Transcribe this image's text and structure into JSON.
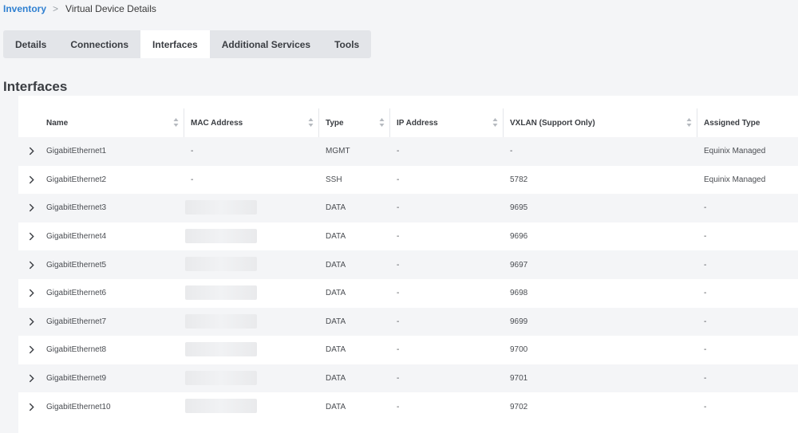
{
  "breadcrumb": {
    "root": "Inventory",
    "separator": ">",
    "current": "Virtual Device Details"
  },
  "tabs": [
    {
      "label": "Details",
      "active": false
    },
    {
      "label": "Connections",
      "active": false
    },
    {
      "label": "Interfaces",
      "active": true
    },
    {
      "label": "Additional Services",
      "active": false
    },
    {
      "label": "Tools",
      "active": false
    }
  ],
  "section_title": "Interfaces",
  "table": {
    "columns": [
      "Name",
      "MAC Address",
      "Type",
      "IP Address",
      "VXLAN (Support Only)",
      "Assigned Type"
    ],
    "rows": [
      {
        "name": "GigabitEthernet1",
        "mac": "-",
        "type": "MGMT",
        "ip": "-",
        "vxlan": "-",
        "assigned": "Equinix Managed",
        "mac_redacted": false
      },
      {
        "name": "GigabitEthernet2",
        "mac": "-",
        "type": "SSH",
        "ip": "-",
        "vxlan": "5782",
        "assigned": "Equinix Managed",
        "mac_redacted": false
      },
      {
        "name": "GigabitEthernet3",
        "mac": "",
        "type": "DATA",
        "ip": "-",
        "vxlan": "9695",
        "assigned": "-",
        "mac_redacted": true
      },
      {
        "name": "GigabitEthernet4",
        "mac": "",
        "type": "DATA",
        "ip": "-",
        "vxlan": "9696",
        "assigned": "-",
        "mac_redacted": true
      },
      {
        "name": "GigabitEthernet5",
        "mac": "",
        "type": "DATA",
        "ip": "-",
        "vxlan": "9697",
        "assigned": "-",
        "mac_redacted": true
      },
      {
        "name": "GigabitEthernet6",
        "mac": "",
        "type": "DATA",
        "ip": "-",
        "vxlan": "9698",
        "assigned": "-",
        "mac_redacted": true
      },
      {
        "name": "GigabitEthernet7",
        "mac": "",
        "type": "DATA",
        "ip": "-",
        "vxlan": "9699",
        "assigned": "-",
        "mac_redacted": true
      },
      {
        "name": "GigabitEthernet8",
        "mac": "",
        "type": "DATA",
        "ip": "-",
        "vxlan": "9700",
        "assigned": "-",
        "mac_redacted": true
      },
      {
        "name": "GigabitEthernet9",
        "mac": "",
        "type": "DATA",
        "ip": "-",
        "vxlan": "9701",
        "assigned": "-",
        "mac_redacted": true
      },
      {
        "name": "GigabitEthernet10",
        "mac": "",
        "type": "DATA",
        "ip": "-",
        "vxlan": "9702",
        "assigned": "-",
        "mac_redacted": true
      }
    ]
  },
  "icons": {
    "breadcrumb_separator": "chevron-right-icon",
    "sort": "sort-arrows-icon",
    "row_expand": "chevron-right-icon"
  },
  "colors": {
    "link": "#2f80d1",
    "page_bg": "#f4f5f7",
    "tab_bar_bg": "#e3e5e9",
    "stripe": "#f4f5f7"
  }
}
